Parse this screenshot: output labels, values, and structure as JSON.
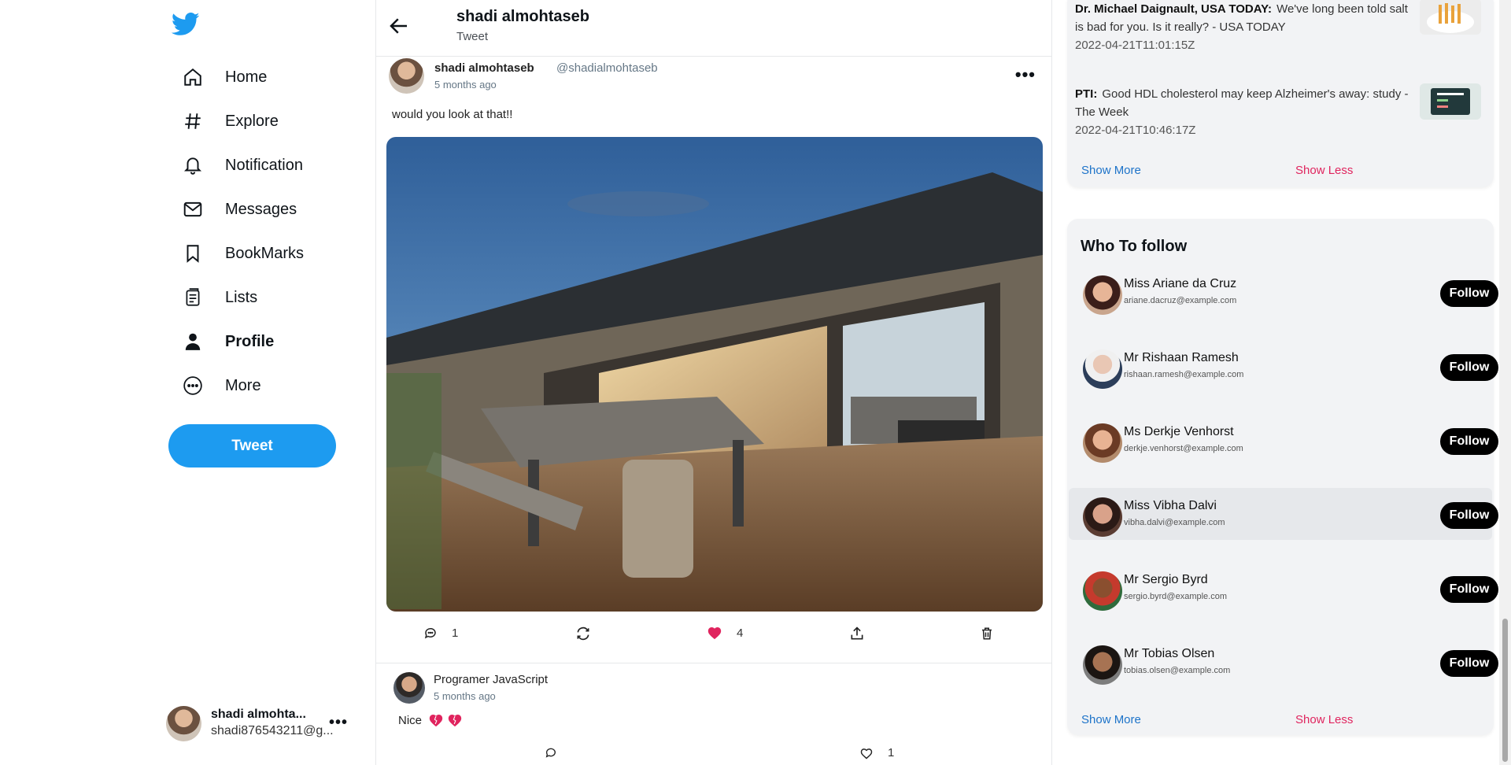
{
  "sidebar": {
    "nav": [
      {
        "label": "Home",
        "icon": "home-icon"
      },
      {
        "label": "Explore",
        "icon": "hash-icon"
      },
      {
        "label": "Notification",
        "icon": "bell-icon"
      },
      {
        "label": "Messages",
        "icon": "mail-icon"
      },
      {
        "label": "BookMarks",
        "icon": "bookmark-icon"
      },
      {
        "label": "Lists",
        "icon": "list-icon"
      },
      {
        "label": "Profile",
        "icon": "person-icon"
      },
      {
        "label": "More",
        "icon": "more-circle-icon"
      }
    ],
    "tweet_button": "Tweet",
    "account": {
      "name": "shadi almohta...",
      "email": "shadi876543211@g...",
      "menu": "•••"
    }
  },
  "header": {
    "title": "shadi almohtaseb",
    "subtitle": "Tweet"
  },
  "post": {
    "author": "shadi almohtaseb",
    "handle": "@shadialmohtaseb",
    "time": "5 months ago",
    "menu": "•••",
    "text": "would you look at that!!",
    "replies": "1",
    "likes": "4"
  },
  "reply": {
    "author": "Programer JavaScript",
    "time": "5 months ago",
    "text": "Nice",
    "likes": "1"
  },
  "news": {
    "items": [
      {
        "source": "Dr. Michael Daignault, USA TODAY:",
        "headline": "We've long been told salt is bad for you. Is it really? - USA TODAY",
        "date": "2022-04-21T11:01:15Z"
      },
      {
        "source": "PTI:",
        "headline": "Good HDL cholesterol may keep Alzheimer's away: study - The Week",
        "date": "2022-04-21T10:46:17Z"
      }
    ],
    "show_more": "Show More",
    "show_less": "Show Less"
  },
  "who_to_follow": {
    "title": "Who To follow",
    "button": "Follow",
    "users": [
      {
        "name": "Miss Ariane da Cruz",
        "email": "ariane.dacruz@example.com"
      },
      {
        "name": "Mr Rishaan Ramesh",
        "email": "rishaan.ramesh@example.com"
      },
      {
        "name": "Ms Derkje Venhorst",
        "email": "derkje.venhorst@example.com"
      },
      {
        "name": "Miss Vibha Dalvi",
        "email": "vibha.dalvi@example.com"
      },
      {
        "name": "Mr Sergio Byrd",
        "email": "sergio.byrd@example.com"
      },
      {
        "name": "Mr Tobias Olsen",
        "email": "tobias.olsen@example.com"
      }
    ],
    "show_more": "Show More",
    "show_less": "Show Less"
  },
  "colors": {
    "brand": "#1d9bf0",
    "like": "#e0245e",
    "link": "#1d73c9"
  }
}
